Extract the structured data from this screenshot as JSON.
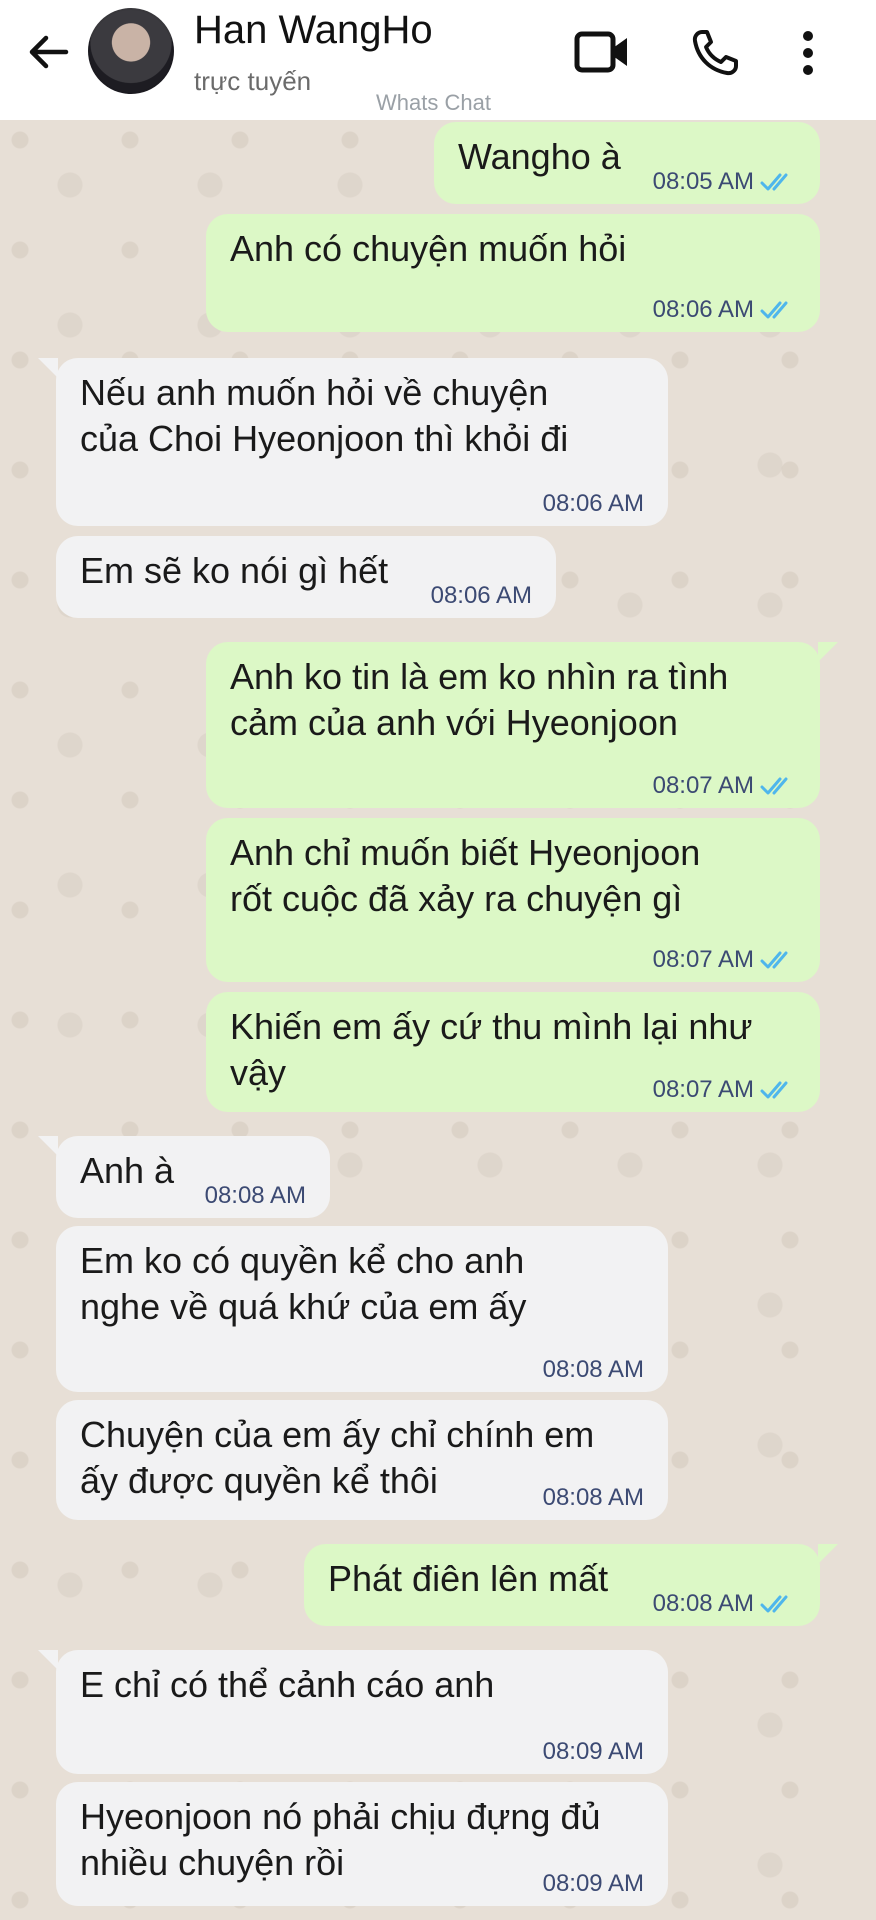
{
  "header": {
    "contact_name": "Han WangHo",
    "status": "trực tuyến",
    "watermark": "Whats Chat"
  },
  "messages": [
    {
      "dir": "out",
      "text": "Wangho à",
      "time": "08:05 AM",
      "read": true
    },
    {
      "dir": "out",
      "text": "Anh có chuyện muốn hỏi",
      "time": "08:06 AM",
      "read": true
    },
    {
      "dir": "in",
      "text": "Nếu anh muốn hỏi về chuyện\ncủa Choi Hyeonjoon thì khỏi đi",
      "time": "08:06 AM"
    },
    {
      "dir": "in",
      "text": "Em sẽ ko nói gì hết",
      "time": "08:06 AM"
    },
    {
      "dir": "out",
      "text": "Anh ko tin là em ko nhìn ra tình\ncảm của anh với Hyeonjoon",
      "time": "08:07 AM",
      "read": true
    },
    {
      "dir": "out",
      "text": "Anh chỉ muốn biết Hyeonjoon\nrốt cuộc đã xảy ra chuyện gì",
      "time": "08:07 AM",
      "read": true
    },
    {
      "dir": "out",
      "text": "Khiến em ấy cứ thu mình lại như\nvậy",
      "time": "08:07 AM",
      "read": true
    },
    {
      "dir": "in",
      "text": "Anh à",
      "time": "08:08 AM"
    },
    {
      "dir": "in",
      "text": "Em ko có quyền kể cho anh\nnghe về quá khứ của em ấy",
      "time": "08:08 AM"
    },
    {
      "dir": "in",
      "text": "Chuyện của em ấy chỉ chính em\nấy được quyền kể thôi",
      "time": "08:08 AM"
    },
    {
      "dir": "out",
      "text": "Phát điên lên mất",
      "time": "08:08 AM",
      "read": true
    },
    {
      "dir": "in",
      "text": "E chỉ có thể cảnh cáo anh",
      "time": "08:09 AM"
    },
    {
      "dir": "in",
      "text": "Hyeonjoon nó phải chịu đựng đủ\nnhiều chuyện rồi",
      "time": "08:09 AM"
    }
  ],
  "colors": {
    "outgoing_bubble": "#dcf8c6",
    "incoming_bubble": "#f2f2f3",
    "read_ticks": "#4fb6ec",
    "timestamp": "#3c4a73"
  },
  "icons": [
    "back-arrow-icon",
    "video-call-icon",
    "phone-icon",
    "more-options-icon",
    "double-check-icon"
  ]
}
